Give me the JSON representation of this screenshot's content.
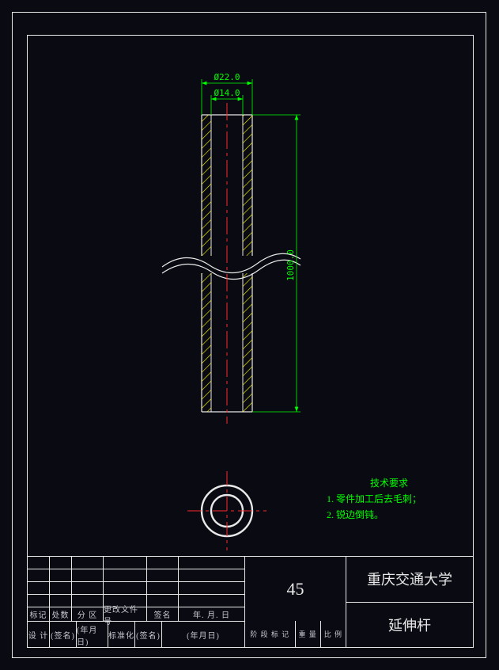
{
  "chart_data": {
    "type": "engineering_drawing",
    "part_name": "延伸杆",
    "material_code": "45",
    "institution": "重庆交通大学",
    "dimensions": {
      "outer_diameter": "Ø22.0",
      "inner_diameter": "Ø14.0",
      "length": "1000.0"
    },
    "notes": {
      "heading": "技术要求",
      "items": [
        "零件加工后去毛刺；",
        "锐边倒钝。"
      ]
    },
    "views": [
      "front_section_broken",
      "end_circle_section"
    ]
  },
  "dims": {
    "od": "Ø22.0",
    "id": "Ø14.0",
    "len": "1000.0"
  },
  "notes": {
    "heading": "技术要求",
    "l1_num": "1.",
    "l1": "零件加工后去毛刺；",
    "l2_num": "2.",
    "l2": "锐边倒钝。"
  },
  "titleblock": {
    "material": "45",
    "institution": "重庆交通大学",
    "part": "延伸杆",
    "h_mark": "标记",
    "h_loc": "处数",
    "h_zone": "分 区",
    "h_chgdoc": "更改文件号",
    "h_sign": "签名",
    "h_date": "年. 月. 日",
    "h_design": "设 计",
    "h_signp": "(签名)",
    "h_datep": "(年月日)",
    "h_std": "标准化",
    "h_stage": "阶 段 标 记",
    "h_mass": "重 量",
    "h_scale": "比 例"
  }
}
